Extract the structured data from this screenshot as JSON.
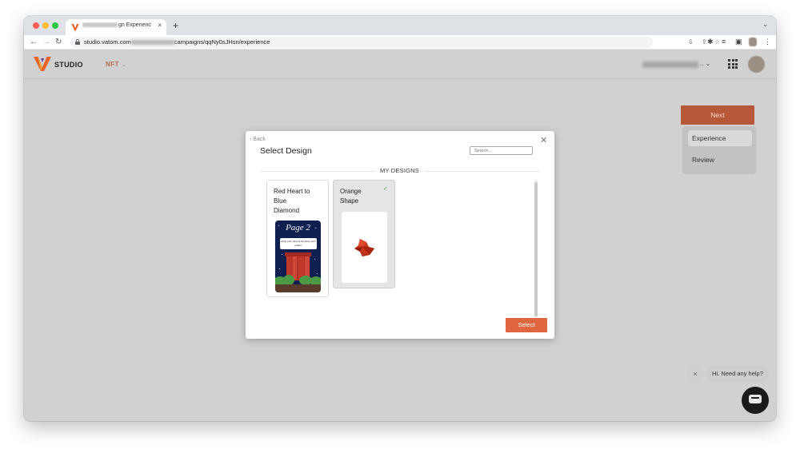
{
  "browser": {
    "tab_title": "gn Experienc",
    "tab_close": "×",
    "new_tab": "+",
    "tab_menu": "⌄",
    "url_prefix": "studio.vatom.com",
    "url_suffix": "campaigns/qqNy0sJHsn/experience"
  },
  "app": {
    "logo_text": "STUDIO",
    "nav_menu_label": "NFT",
    "account_suffix": "..",
    "brand_color": "#e0663f"
  },
  "sidebar": {
    "next_label": "Next",
    "steps": [
      {
        "label": "Experience",
        "active": true
      },
      {
        "label": "Review",
        "active": false
      }
    ]
  },
  "modal": {
    "back_label": "Back",
    "title": "Select Design",
    "search_placeholder": "Search...",
    "section_label": "MY DESIGNS",
    "designs": [
      {
        "name": "Red Heart to Blue Diamond",
        "name_lines": [
          "Red Heart to",
          "Blue",
          "Diamond"
        ],
        "thumbnail_title": "Page 2",
        "thumbnail_note": "Drop your clues at the bin to earn points!",
        "selected": false
      },
      {
        "name": "Orange Shape",
        "name_lines": [
          "Orange",
          "Shape"
        ],
        "selected": true
      }
    ],
    "select_label": "Select"
  },
  "chat": {
    "bubble_text": "Hi. Need any help?",
    "close_icon": "×"
  }
}
